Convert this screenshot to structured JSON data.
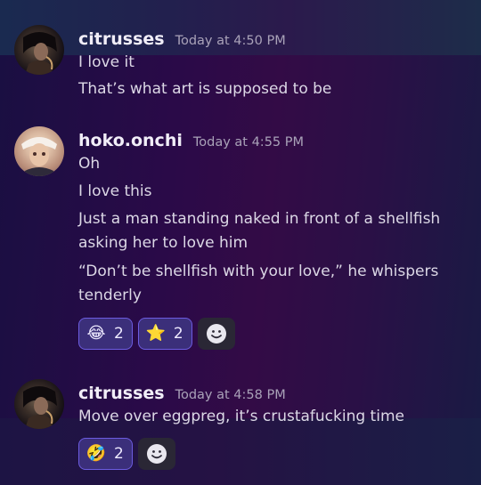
{
  "messages": [
    {
      "username": "citrusses",
      "timestamp": "Today at 4:50 PM",
      "lines": [
        "I love it",
        "That’s what art is supposed to be"
      ],
      "reactions": []
    },
    {
      "username": "hoko.onchi",
      "timestamp": "Today at 4:55 PM",
      "lines": [
        "Oh",
        "I love this",
        "Just a man standing naked in front of a shellfish",
        "asking her to love him",
        "“Don’t be shellfish with your love,” he whispers",
        "tenderly"
      ],
      "reactions": [
        {
          "emoji": "😂",
          "icon": "joy-emoji-icon",
          "count": "2"
        },
        {
          "emoji": "⭐",
          "icon": "star-emoji-icon",
          "count": "2"
        }
      ]
    },
    {
      "username": "citrusses",
      "timestamp": "Today at 4:58 PM",
      "lines": [
        "Move over eggpreg, it’s crustafucking time"
      ],
      "reactions": [
        {
          "emoji": "🤣",
          "icon": "rofl-emoji-icon",
          "count": "2"
        }
      ]
    }
  ],
  "colors": {
    "reaction_bg": "#3b2f7a",
    "reaction_border": "#6c5ce0",
    "username": "#f1eef8",
    "timestamp": "#a9a2b8"
  }
}
